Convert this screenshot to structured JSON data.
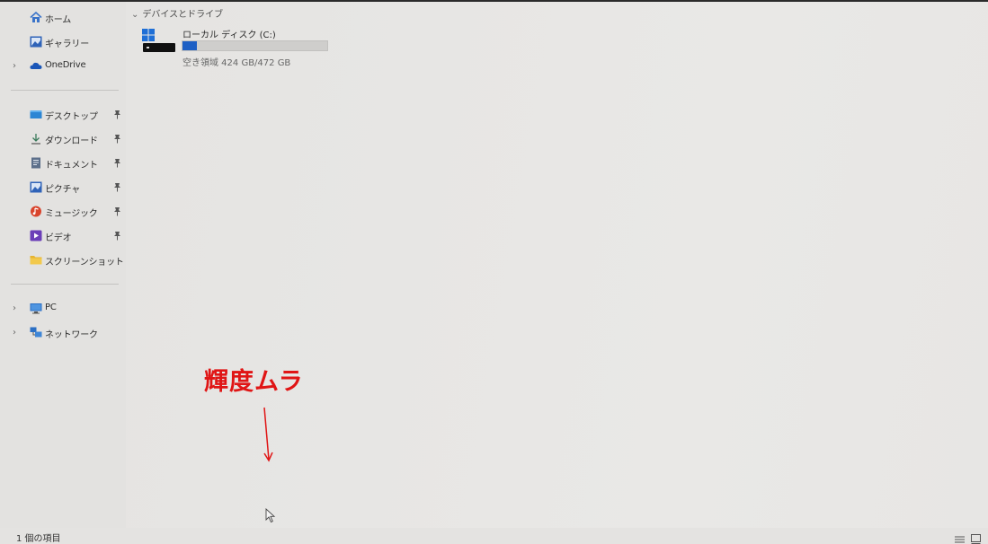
{
  "sidebar": {
    "top_items": [
      {
        "label": "ホーム",
        "icon": "home-icon"
      },
      {
        "label": "ギャラリー",
        "icon": "gallery-icon"
      },
      {
        "label": "OneDrive",
        "icon": "onedrive-cloud-icon",
        "expandable": true
      }
    ],
    "quick_access": [
      {
        "label": "デスクトップ",
        "icon": "desktop-folder-icon",
        "pinned": true
      },
      {
        "label": "ダウンロード",
        "icon": "download-icon",
        "pinned": true
      },
      {
        "label": "ドキュメント",
        "icon": "documents-icon",
        "pinned": true
      },
      {
        "label": "ピクチャ",
        "icon": "pictures-icon",
        "pinned": true
      },
      {
        "label": "ミュージック",
        "icon": "music-icon",
        "pinned": true
      },
      {
        "label": "ビデオ",
        "icon": "videos-icon",
        "pinned": true
      },
      {
        "label": "スクリーンショット",
        "icon": "folder-icon",
        "pinned": false
      }
    ],
    "devices": [
      {
        "label": "PC",
        "icon": "pc-monitor-icon",
        "expandable": true
      },
      {
        "label": "ネットワーク",
        "icon": "network-icon",
        "expandable": true
      }
    ]
  },
  "content": {
    "section_header": "デバイスとドライブ",
    "drive": {
      "name": "ローカル ディスク (C:)",
      "free_text": "空き領域 424 GB/472 GB",
      "used_fraction": 0.102,
      "bar_color": "#1d5fc4"
    }
  },
  "annotation": {
    "text": "輝度ムラ",
    "color": "#e01515"
  },
  "statusbar": {
    "item_count": "1 個の項目"
  },
  "colors": {
    "accent": "#1d5fc4",
    "background": "#e6e5e3"
  }
}
